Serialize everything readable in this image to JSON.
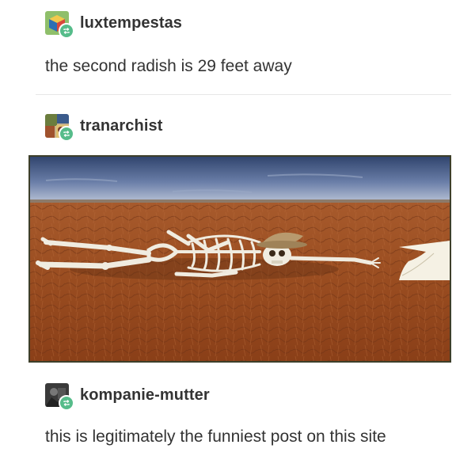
{
  "posts": [
    {
      "username": "luxtempestas",
      "text": "the second radish is 29 feet away",
      "avatar_icon": "cube-avatar-icon"
    },
    {
      "username": "tranarchist",
      "avatar_icon": "collage-avatar-icon",
      "image_description_icon": "desert-skeleton-photo"
    },
    {
      "username": "kompanie-mutter",
      "text": "this is legitimately the funniest post on this site",
      "avatar_icon": "photo-avatar-icon"
    }
  ],
  "badge_icon": "reblog-icon",
  "colors": {
    "text": "#333333",
    "reblog_badge": "#56bc8a",
    "divider": "#e6e6e6"
  }
}
